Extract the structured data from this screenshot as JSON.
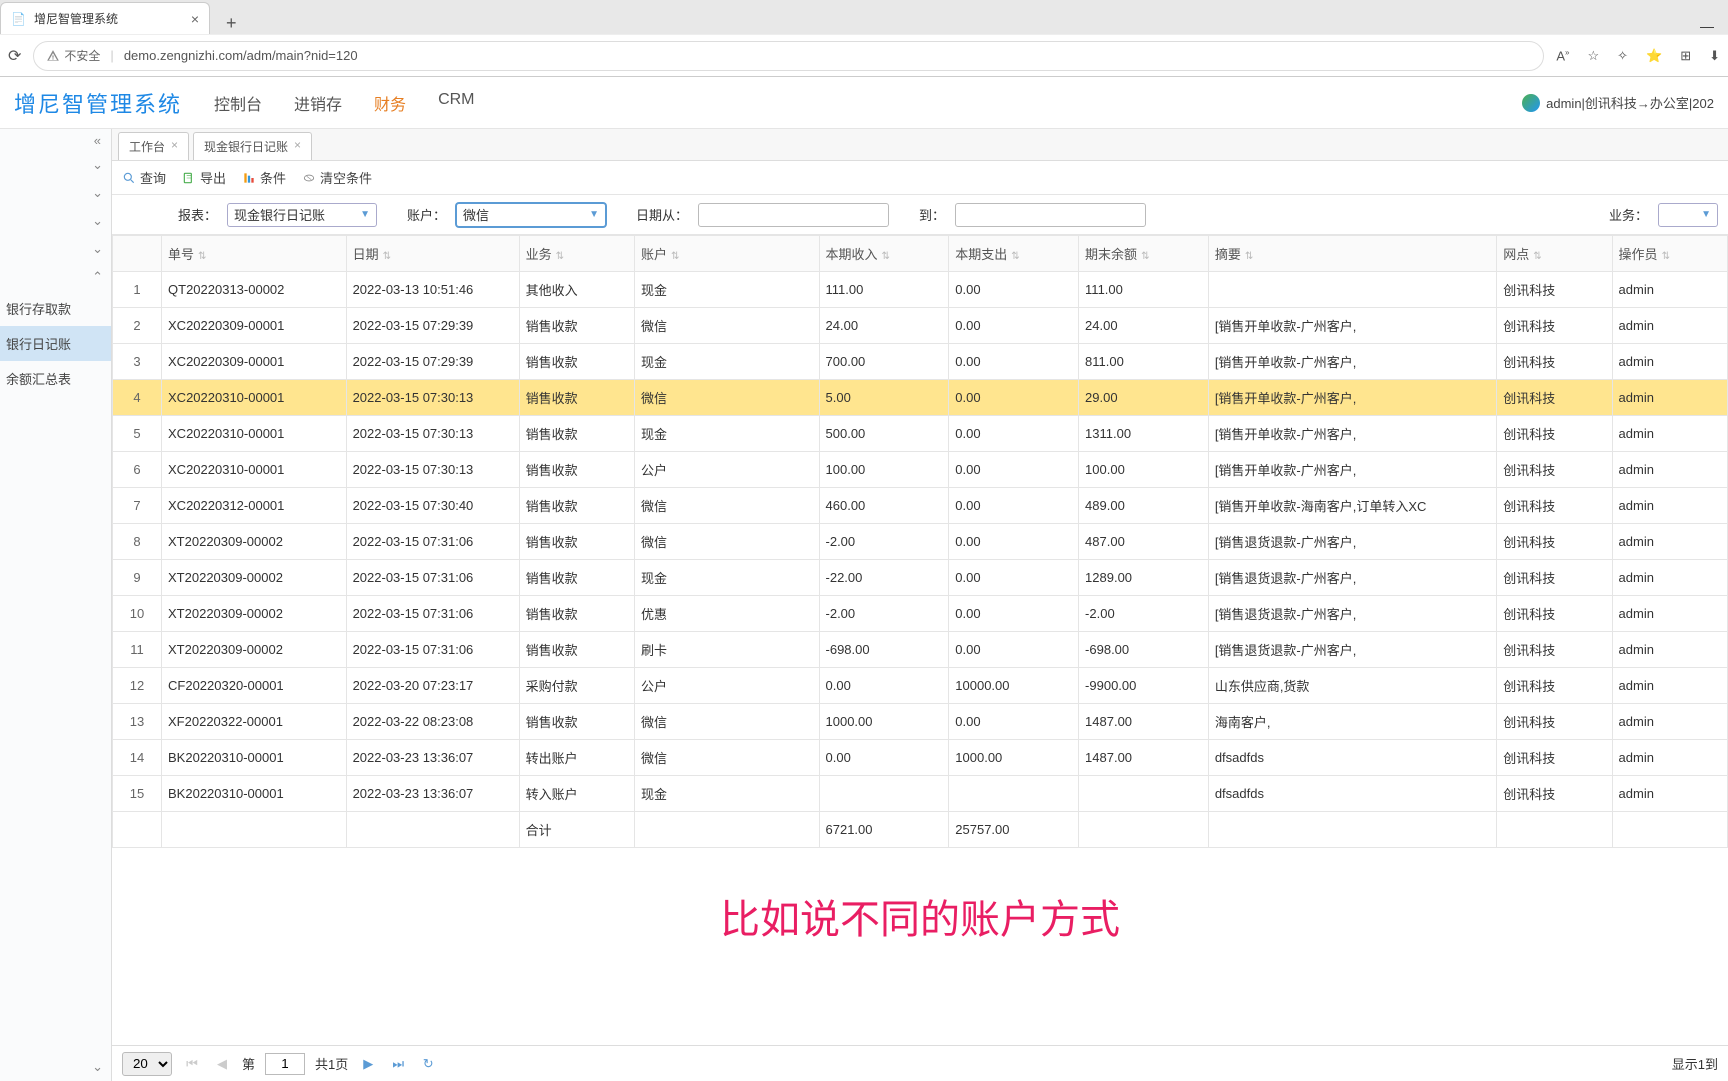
{
  "browser": {
    "tab_title": "增尼智管理系统",
    "insecure_label": "不安全",
    "url": "demo.zengnizhi.com/adm/main?nid=120"
  },
  "app": {
    "title": "增尼智管理系统",
    "nav": [
      "控制台",
      "进销存",
      "财务",
      "CRM"
    ],
    "nav_active": 2,
    "user_text": "admin|创讯科技→办公室|202"
  },
  "sidebar": {
    "items": [
      "银行存取款",
      "银行日记账",
      "余额汇总表"
    ],
    "active_index": 1
  },
  "tabs": [
    {
      "label": "工作台",
      "closable": true
    },
    {
      "label": "现金银行日记账",
      "closable": true
    }
  ],
  "toolbar": {
    "search": "查询",
    "export": "导出",
    "conditions": "条件",
    "clear": "清空条件"
  },
  "filters": {
    "report_label": "报表：",
    "report_value": "现金银行日记账",
    "account_label": "账户：",
    "account_value": "微信",
    "date_from_label": "日期从：",
    "date_to_label": "到：",
    "business_label": "业务："
  },
  "columns": [
    "单号",
    "日期",
    "业务",
    "账户",
    "本期收入",
    "本期支出",
    "期末余额",
    "摘要",
    "网点",
    "操作员"
  ],
  "rows": [
    {
      "n": 1,
      "danhao": "QT20220313-00002",
      "riqi": "2022-03-13 10:51:46",
      "yewu": "其他收入",
      "zhanghu": "现金",
      "shouru": "111.00",
      "zhichu": "0.00",
      "yue": "111.00",
      "zhaiyao": "",
      "wangdian": "创讯科技",
      "caozuo": "admin"
    },
    {
      "n": 2,
      "danhao": "XC20220309-00001",
      "riqi": "2022-03-15 07:29:39",
      "yewu": "销售收款",
      "zhanghu": "微信",
      "shouru": "24.00",
      "zhichu": "0.00",
      "yue": "24.00",
      "zhaiyao": "[销售开单收款-广州客户,",
      "wangdian": "创讯科技",
      "caozuo": "admin"
    },
    {
      "n": 3,
      "danhao": "XC20220309-00001",
      "riqi": "2022-03-15 07:29:39",
      "yewu": "销售收款",
      "zhanghu": "现金",
      "shouru": "700.00",
      "zhichu": "0.00",
      "yue": "811.00",
      "zhaiyao": "[销售开单收款-广州客户,",
      "wangdian": "创讯科技",
      "caozuo": "admin"
    },
    {
      "n": 4,
      "danhao": "XC20220310-00001",
      "riqi": "2022-03-15 07:30:13",
      "yewu": "销售收款",
      "zhanghu": "微信",
      "shouru": "5.00",
      "zhichu": "0.00",
      "yue": "29.00",
      "zhaiyao": "[销售开单收款-广州客户,",
      "wangdian": "创讯科技",
      "caozuo": "admin",
      "hl": true
    },
    {
      "n": 5,
      "danhao": "XC20220310-00001",
      "riqi": "2022-03-15 07:30:13",
      "yewu": "销售收款",
      "zhanghu": "现金",
      "shouru": "500.00",
      "zhichu": "0.00",
      "yue": "1311.00",
      "zhaiyao": "[销售开单收款-广州客户,",
      "wangdian": "创讯科技",
      "caozuo": "admin"
    },
    {
      "n": 6,
      "danhao": "XC20220310-00001",
      "riqi": "2022-03-15 07:30:13",
      "yewu": "销售收款",
      "zhanghu": "公户",
      "shouru": "100.00",
      "zhichu": "0.00",
      "yue": "100.00",
      "zhaiyao": "[销售开单收款-广州客户,",
      "wangdian": "创讯科技",
      "caozuo": "admin"
    },
    {
      "n": 7,
      "danhao": "XC20220312-00001",
      "riqi": "2022-03-15 07:30:40",
      "yewu": "销售收款",
      "zhanghu": "微信",
      "shouru": "460.00",
      "zhichu": "0.00",
      "yue": "489.00",
      "zhaiyao": "[销售开单收款-海南客户,订单转入XC",
      "wangdian": "创讯科技",
      "caozuo": "admin"
    },
    {
      "n": 8,
      "danhao": "XT20220309-00002",
      "riqi": "2022-03-15 07:31:06",
      "yewu": "销售收款",
      "zhanghu": "微信",
      "shouru": "-2.00",
      "zhichu": "0.00",
      "yue": "487.00",
      "zhaiyao": "[销售退货退款-广州客户,",
      "wangdian": "创讯科技",
      "caozuo": "admin"
    },
    {
      "n": 9,
      "danhao": "XT20220309-00002",
      "riqi": "2022-03-15 07:31:06",
      "yewu": "销售收款",
      "zhanghu": "现金",
      "shouru": "-22.00",
      "zhichu": "0.00",
      "yue": "1289.00",
      "zhaiyao": "[销售退货退款-广州客户,",
      "wangdian": "创讯科技",
      "caozuo": "admin"
    },
    {
      "n": 10,
      "danhao": "XT20220309-00002",
      "riqi": "2022-03-15 07:31:06",
      "yewu": "销售收款",
      "zhanghu": "优惠",
      "shouru": "-2.00",
      "zhichu": "0.00",
      "yue": "-2.00",
      "zhaiyao": "[销售退货退款-广州客户,",
      "wangdian": "创讯科技",
      "caozuo": "admin"
    },
    {
      "n": 11,
      "danhao": "XT20220309-00002",
      "riqi": "2022-03-15 07:31:06",
      "yewu": "销售收款",
      "zhanghu": "刷卡",
      "shouru": "-698.00",
      "zhichu": "0.00",
      "yue": "-698.00",
      "zhaiyao": "[销售退货退款-广州客户,",
      "wangdian": "创讯科技",
      "caozuo": "admin"
    },
    {
      "n": 12,
      "danhao": "CF20220320-00001",
      "riqi": "2022-03-20 07:23:17",
      "yewu": "采购付款",
      "zhanghu": "公户",
      "shouru": "0.00",
      "zhichu": "10000.00",
      "yue": "-9900.00",
      "zhaiyao": "山东供应商,货款",
      "wangdian": "创讯科技",
      "caozuo": "admin"
    },
    {
      "n": 13,
      "danhao": "XF20220322-00001",
      "riqi": "2022-03-22 08:23:08",
      "yewu": "销售收款",
      "zhanghu": "微信",
      "shouru": "1000.00",
      "zhichu": "0.00",
      "yue": "1487.00",
      "zhaiyao": "海南客户,",
      "wangdian": "创讯科技",
      "caozuo": "admin"
    },
    {
      "n": 14,
      "danhao": "BK20220310-00001",
      "riqi": "2022-03-23 13:36:07",
      "yewu": "转出账户",
      "zhanghu": "微信",
      "shouru": "0.00",
      "zhichu": "1000.00",
      "yue": "1487.00",
      "zhaiyao": "dfsadfds",
      "wangdian": "创讯科技",
      "caozuo": "admin"
    },
    {
      "n": 15,
      "danhao": "BK20220310-00001",
      "riqi": "2022-03-23 13:36:07",
      "yewu": "转入账户",
      "zhanghu": "现金",
      "shouru": "",
      "zhichu": "",
      "yue": "",
      "zhaiyao": "dfsadfds",
      "wangdian": "创讯科技",
      "caozuo": "admin"
    }
  ],
  "footer": {
    "label": "合计",
    "shouru": "6721.00",
    "zhichu": "25757.00"
  },
  "pagination": {
    "page_size": "20",
    "page_label_prefix": "第",
    "page": "1",
    "total_pages_label": "共1页",
    "info": "显示1到"
  },
  "subtitle": "比如说不同的账户方式"
}
